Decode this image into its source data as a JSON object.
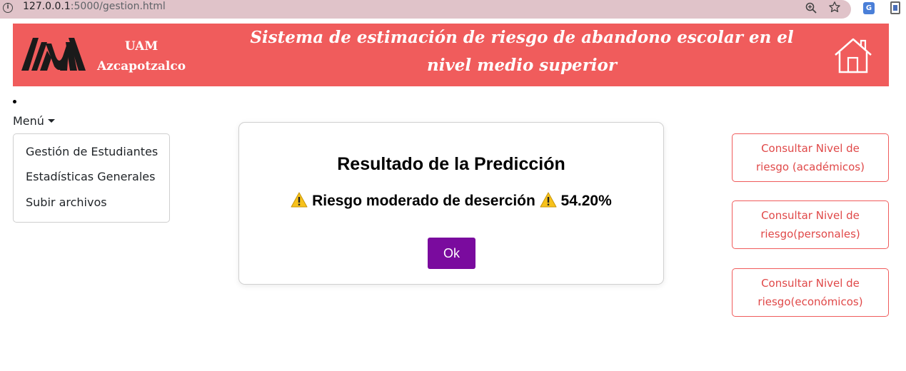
{
  "browser": {
    "url_host": "127.0.0.1",
    "url_path": ":5000/gestion.html",
    "icons": [
      "info-icon",
      "zoom-icon",
      "star-icon",
      "translate-icon",
      "extension-icon"
    ]
  },
  "header": {
    "org_line1": "UAM",
    "org_line2": "Azcapotzalco",
    "title": "Sistema de estimación de riesgo de abandono escolar en el nivel medio superior",
    "background_color": "#f05c5c",
    "home_icon": "home-icon"
  },
  "menu": {
    "toggle_label": "Menú",
    "items": [
      {
        "label": "Gestión de Estudiantes"
      },
      {
        "label": "Estadísticas Generales"
      },
      {
        "label": "Subir archivos"
      }
    ]
  },
  "modal": {
    "title": "Resultado de la Predicción",
    "message": "Riesgo moderado de deserción",
    "percentage": "54.20%",
    "ok_label": "Ok",
    "ok_color": "#7a0b9e",
    "warning_icon": "warning-icon"
  },
  "right_actions": [
    {
      "label": "Consultar Nivel de riesgo (académicos)"
    },
    {
      "label": "Consultar Nivel de riesgo(personales)"
    },
    {
      "label": "Consultar Nivel de riesgo(económicos)"
    }
  ]
}
